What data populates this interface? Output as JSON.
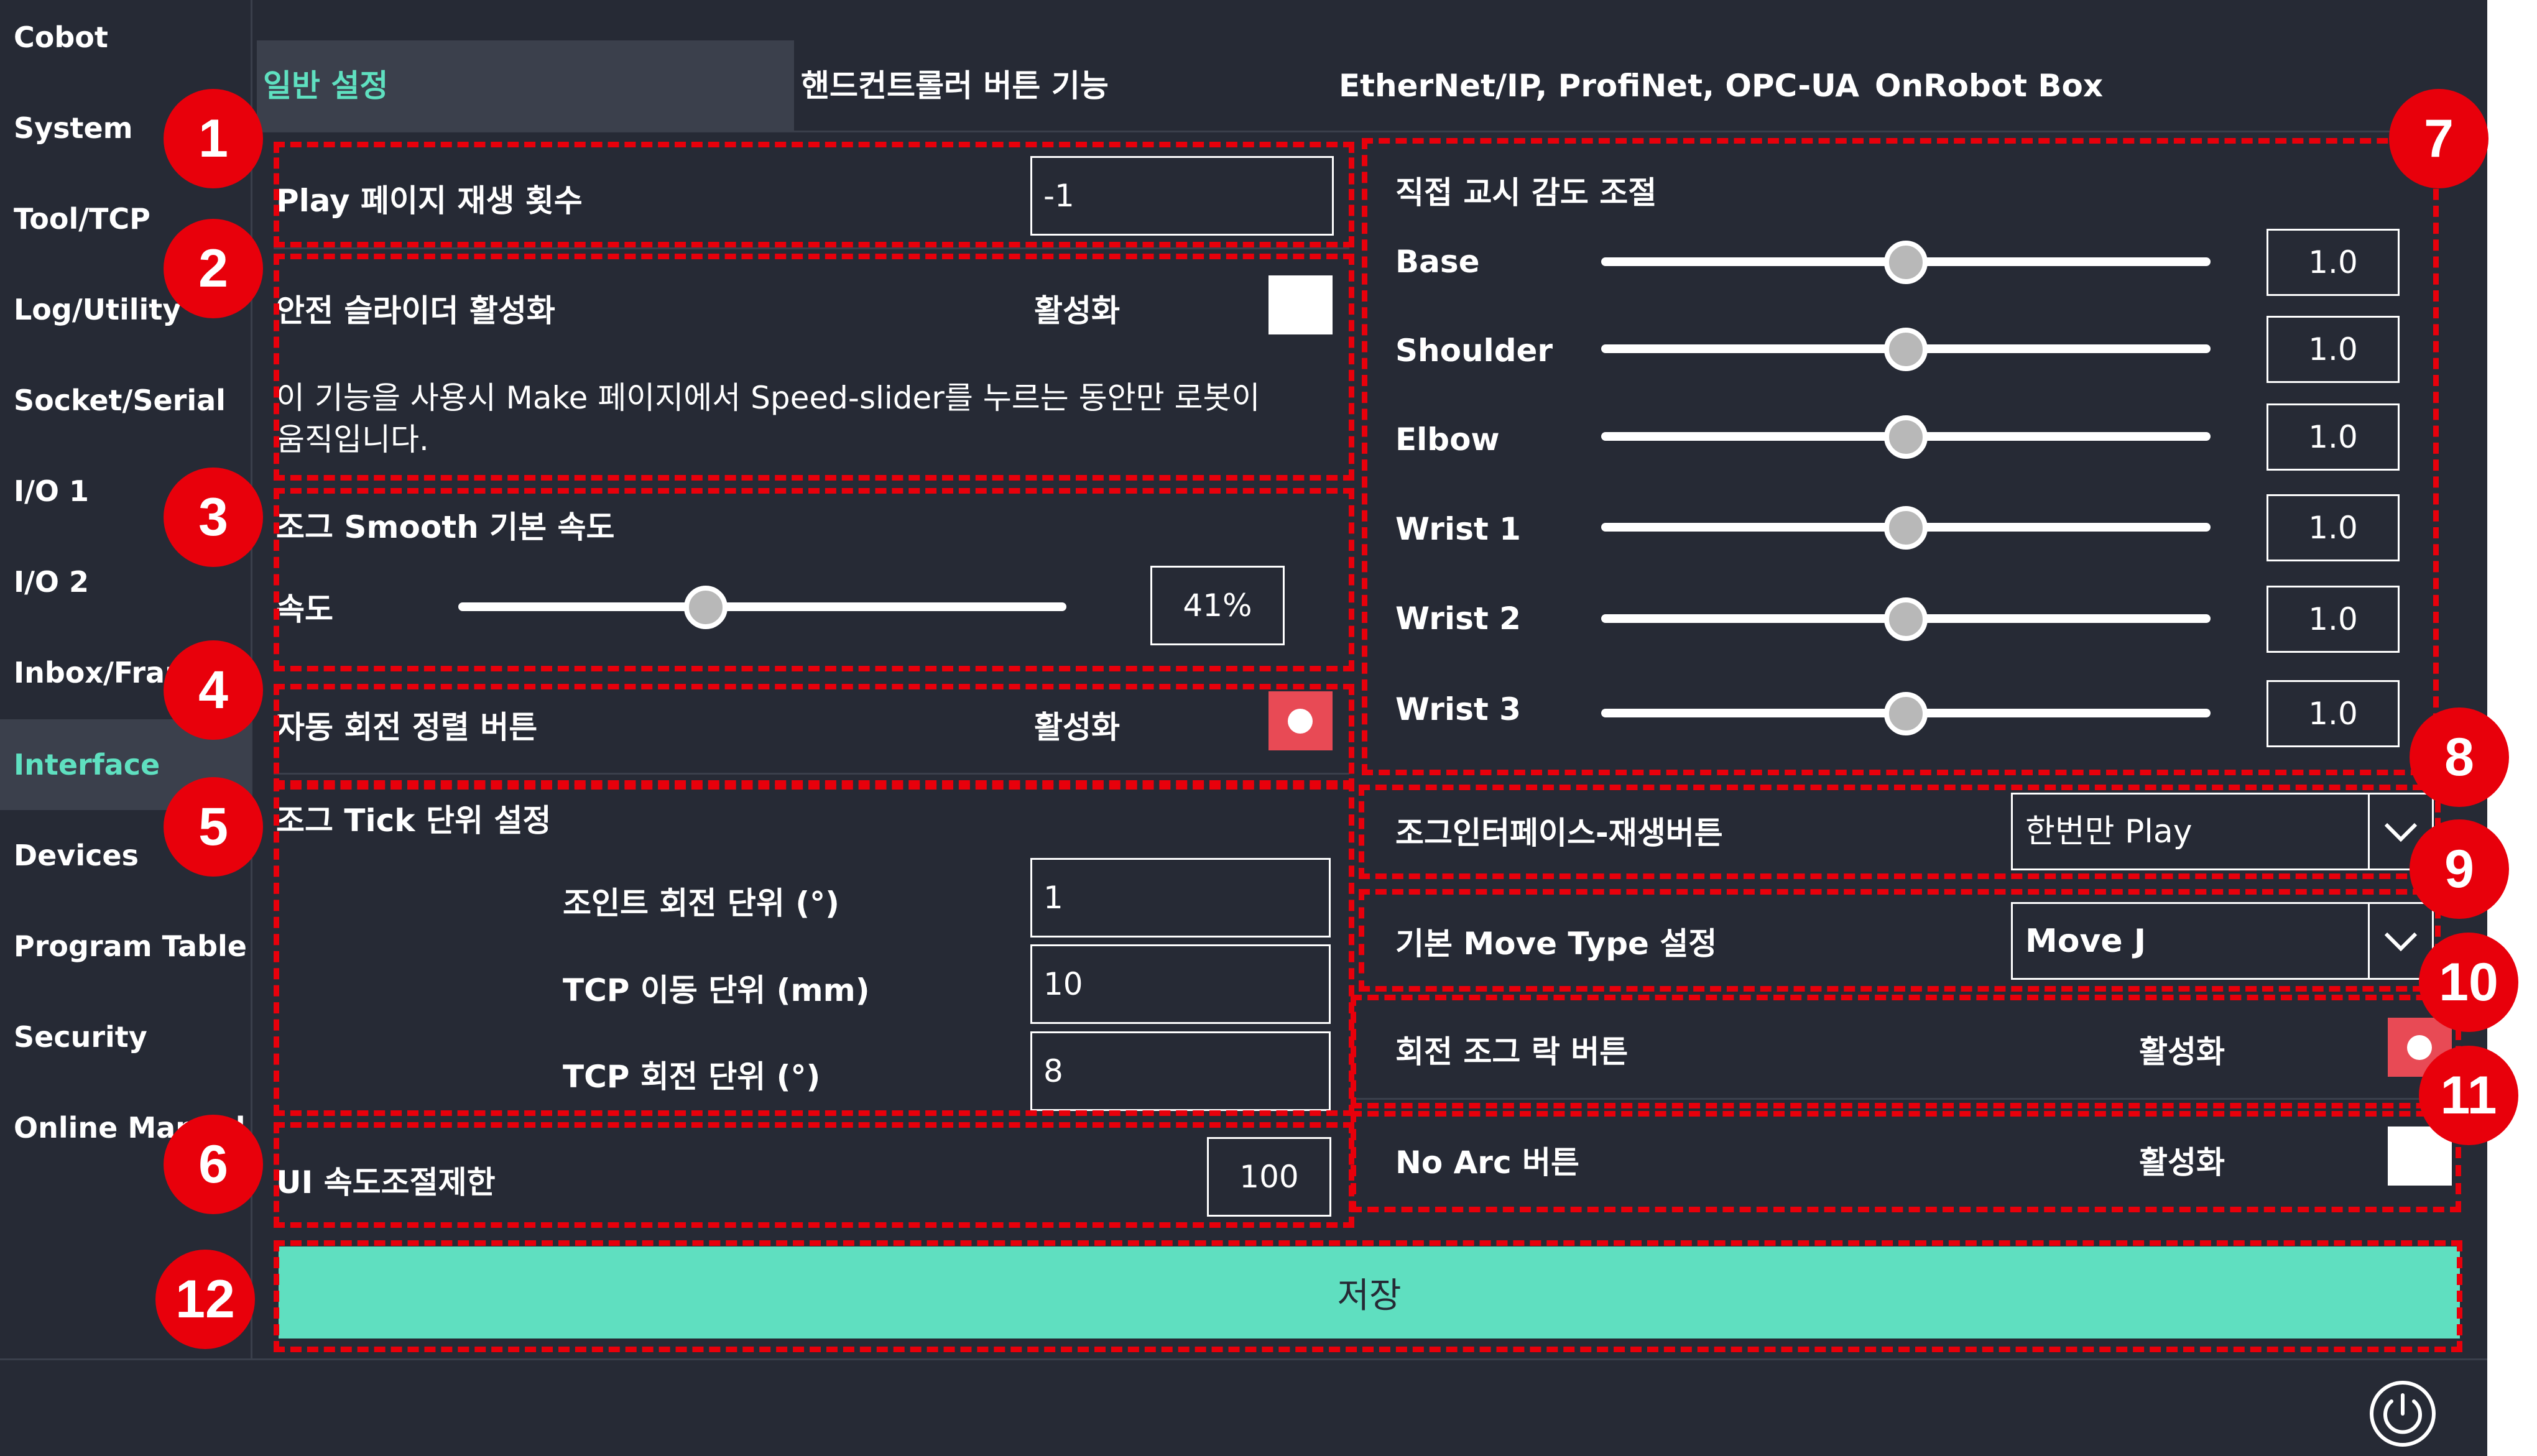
{
  "sidebar": {
    "items": [
      {
        "label": "Cobot"
      },
      {
        "label": "System"
      },
      {
        "label": "Tool/TCP"
      },
      {
        "label": "Log/Utility"
      },
      {
        "label": "Socket/Serial"
      },
      {
        "label": "I/O 1"
      },
      {
        "label": "I/O 2"
      },
      {
        "label": "Inbox/Frame"
      },
      {
        "label": "Interface"
      },
      {
        "label": "Devices"
      },
      {
        "label": "Program Table"
      },
      {
        "label": "Security"
      },
      {
        "label": "Online Manual"
      }
    ]
  },
  "tabs": [
    {
      "label": "일반 설정"
    },
    {
      "label": "핸드컨트롤러 버튼 기능"
    },
    {
      "label": "EtherNet/IP, ProfiNet, OPC-UA"
    },
    {
      "label": "OnRobot Box"
    }
  ],
  "play_repeat": {
    "label": "Play 페이지 재생 횟수",
    "value": "-1"
  },
  "safety_slider": {
    "label": "안전 슬라이더 활성화",
    "status": "활성화",
    "checked": false,
    "description_line1": "이 기능을 사용시 Make 페이지에서 Speed-slider를 누르는 동안만 로봇이",
    "description_line2": "움직입니다."
  },
  "jog_smooth": {
    "label": "조그 Smooth 기본 속도",
    "speed_label": "속도",
    "value": "41%",
    "level": 0.41
  },
  "auto_align": {
    "label": "자동 회전 정렬 버튼",
    "status": "활성화",
    "checked": true
  },
  "jog_tick": {
    "label": "조그 Tick 단위 설정",
    "rows": [
      {
        "label": "조인트 회전 단위 (°)",
        "value": "1"
      },
      {
        "label": "TCP 이동 단위 (mm)",
        "value": "10"
      },
      {
        "label": "TCP 회전 단위 (°)",
        "value": "8"
      }
    ]
  },
  "ui_speed_limit": {
    "label": "UI 속도조절제한",
    "value": "100"
  },
  "direct_teach": {
    "title": "직접 교시 감도 조절",
    "rows": [
      {
        "label": "Base",
        "value": "1.0",
        "level": 0.5
      },
      {
        "label": "Shoulder",
        "value": "1.0",
        "level": 0.5
      },
      {
        "label": "Elbow",
        "value": "1.0",
        "level": 0.5
      },
      {
        "label": "Wrist 1",
        "value": "1.0",
        "level": 0.5
      },
      {
        "label": "Wrist 2",
        "value": "1.0",
        "level": 0.5
      },
      {
        "label": "Wrist 3",
        "value": "1.0",
        "level": 0.5
      }
    ]
  },
  "jog_play_button": {
    "label": "조그인터페이스-재생버튼",
    "selected": "한번만 Play"
  },
  "move_type": {
    "label": "기본 Move Type 설정",
    "selected": "Move J"
  },
  "rotation_jog_lock": {
    "label": "회전 조그 락 버튼",
    "status": "활성화",
    "checked": true
  },
  "no_arc": {
    "label": "No Arc 버튼",
    "status": "활성화",
    "checked": false
  },
  "save_label": "저장",
  "badges": [
    "1",
    "2",
    "3",
    "4",
    "5",
    "6",
    "7",
    "8",
    "9",
    "10",
    "11",
    "12"
  ],
  "colors": {
    "background": "#262a35",
    "accent": "#5fdfc0",
    "annotation": "#e8000b",
    "toggle": "#e84a55"
  },
  "icons": {
    "power": "power-icon",
    "dropdown": "chevron-down-icon"
  }
}
